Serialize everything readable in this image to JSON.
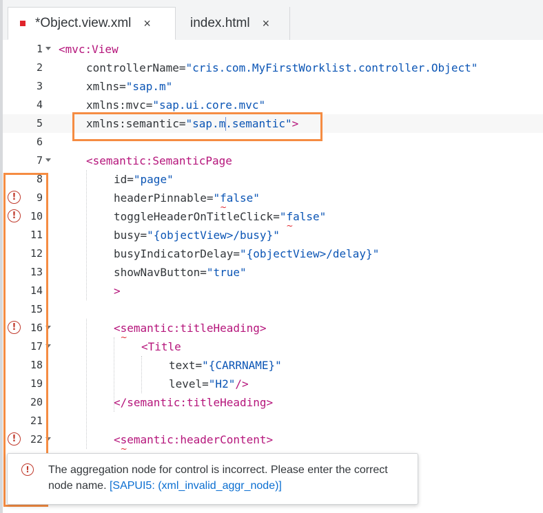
{
  "tabs": [
    {
      "label": "*Object.view.xml",
      "close": "×",
      "active": true
    },
    {
      "label": "index.html",
      "close": "×",
      "active": false
    }
  ],
  "editor": {
    "cursor_line": 5,
    "lines": [
      {
        "n": "1",
        "fold": true,
        "error": false,
        "segments": [
          [
            "tag",
            "<mvc:View"
          ]
        ]
      },
      {
        "n": "2",
        "fold": false,
        "error": false,
        "segments": [
          [
            "attr",
            "controllerName="
          ],
          [
            "val",
            "\"cris.com.MyFirstWorklist.controller.Object\""
          ]
        ]
      },
      {
        "n": "3",
        "fold": false,
        "error": false,
        "segments": [
          [
            "attr",
            "xmlns="
          ],
          [
            "val",
            "\"sap.m\""
          ]
        ]
      },
      {
        "n": "4",
        "fold": false,
        "error": false,
        "segments": [
          [
            "attr",
            "xmlns:mvc="
          ],
          [
            "val",
            "\"sap.ui.core.mvc\""
          ]
        ]
      },
      {
        "n": "5",
        "fold": false,
        "error": false,
        "segments": [
          [
            "attr",
            "xmlns:semantic="
          ],
          [
            "val",
            "\"sap.m.semantic\""
          ],
          [
            "tag",
            ">"
          ]
        ]
      },
      {
        "n": "6",
        "fold": false,
        "error": false,
        "segments": []
      },
      {
        "n": "7",
        "fold": true,
        "error": false,
        "segments": [
          [
            "tag",
            "<semantic:SemanticPage"
          ]
        ]
      },
      {
        "n": "8",
        "fold": false,
        "error": false,
        "segments": [
          [
            "attr",
            "id="
          ],
          [
            "val",
            "\"page\""
          ]
        ]
      },
      {
        "n": "9",
        "fold": false,
        "error": true,
        "segments": [
          [
            "attr",
            "headerPinnable="
          ],
          [
            "val",
            "\"false\""
          ]
        ]
      },
      {
        "n": "10",
        "fold": false,
        "error": true,
        "segments": [
          [
            "attr",
            "toggleHeaderOnTitleClick="
          ],
          [
            "val",
            "\"false\""
          ]
        ]
      },
      {
        "n": "11",
        "fold": false,
        "error": false,
        "segments": [
          [
            "attr",
            "busy="
          ],
          [
            "val",
            "\"{objectView>/busy}\""
          ]
        ]
      },
      {
        "n": "12",
        "fold": false,
        "error": false,
        "segments": [
          [
            "attr",
            "busyIndicatorDelay="
          ],
          [
            "val",
            "\"{objectView>/delay}\""
          ]
        ]
      },
      {
        "n": "13",
        "fold": false,
        "error": false,
        "segments": [
          [
            "attr",
            "showNavButton="
          ],
          [
            "val",
            "\"true\""
          ]
        ]
      },
      {
        "n": "14",
        "fold": false,
        "error": false,
        "segments": [
          [
            "tag",
            ">"
          ]
        ]
      },
      {
        "n": "15",
        "fold": false,
        "error": false,
        "segments": []
      },
      {
        "n": "16",
        "fold": true,
        "error": true,
        "segments": [
          [
            "tag",
            "<semantic:titleHeading>"
          ]
        ]
      },
      {
        "n": "17",
        "fold": true,
        "error": false,
        "segments": [
          [
            "tag",
            "<Title"
          ]
        ]
      },
      {
        "n": "18",
        "fold": false,
        "error": false,
        "segments": [
          [
            "attr",
            "text="
          ],
          [
            "val",
            "\"{CARRNAME}\""
          ]
        ]
      },
      {
        "n": "19",
        "fold": false,
        "error": false,
        "segments": [
          [
            "attr",
            "level="
          ],
          [
            "val",
            "\"H2\""
          ],
          [
            "tag",
            "/>"
          ]
        ]
      },
      {
        "n": "20",
        "fold": false,
        "error": false,
        "segments": [
          [
            "tag",
            "</semantic:titleHeading>"
          ]
        ]
      },
      {
        "n": "21",
        "fold": false,
        "error": false,
        "segments": []
      },
      {
        "n": "22",
        "fold": true,
        "error": true,
        "segments": [
          [
            "tag",
            "<semantic:headerContent>"
          ]
        ]
      }
    ]
  },
  "tooltip": {
    "error_icon": "error-icon",
    "message": "The aggregation node for control is incorrect. Please enter the correct node name. ",
    "link": "[SAPUI5: (xml_invalid_aggr_node)]"
  },
  "colors": {
    "tag": "#b5157b",
    "value": "#0b55b5",
    "error": "#c0392b",
    "annotation": "#f58c42",
    "dirty_marker": "#e0242b"
  }
}
